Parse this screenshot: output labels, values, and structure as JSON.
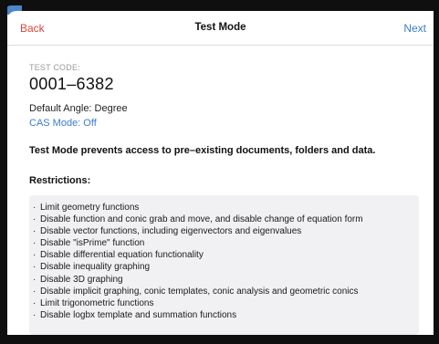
{
  "navbar": {
    "back_label": "Back",
    "title": "Test Mode",
    "next_label": "Next"
  },
  "test_code": {
    "label": "TEST CODE:",
    "value": "0001–6382"
  },
  "settings": {
    "default_angle": "Default Angle: Degree",
    "cas_mode": "CAS Mode: Off"
  },
  "notice": "Test Mode prevents access to pre–existing documents, folders and data.",
  "restrictions": {
    "title": "Restrictions:",
    "bullet": "·",
    "items": [
      "Limit geometry functions",
      "Disable function and conic grab and move, and disable change of equation form",
      "Disable vector functions, including eigenvectors and eigenvalues",
      "Disable \"isPrime\" function",
      "Disable differential equation functionality",
      "Disable inequality graphing",
      "Disable 3D graphing",
      "Disable implicit graphing, conic templates, conic analysis and geometric conics",
      "Limit trigonometric functions",
      "Disable logbx template and summation functions"
    ]
  },
  "colors": {
    "back": "#e0443a",
    "accent": "#3a7bd5",
    "restrictions_bg": "#f1f1f3"
  }
}
